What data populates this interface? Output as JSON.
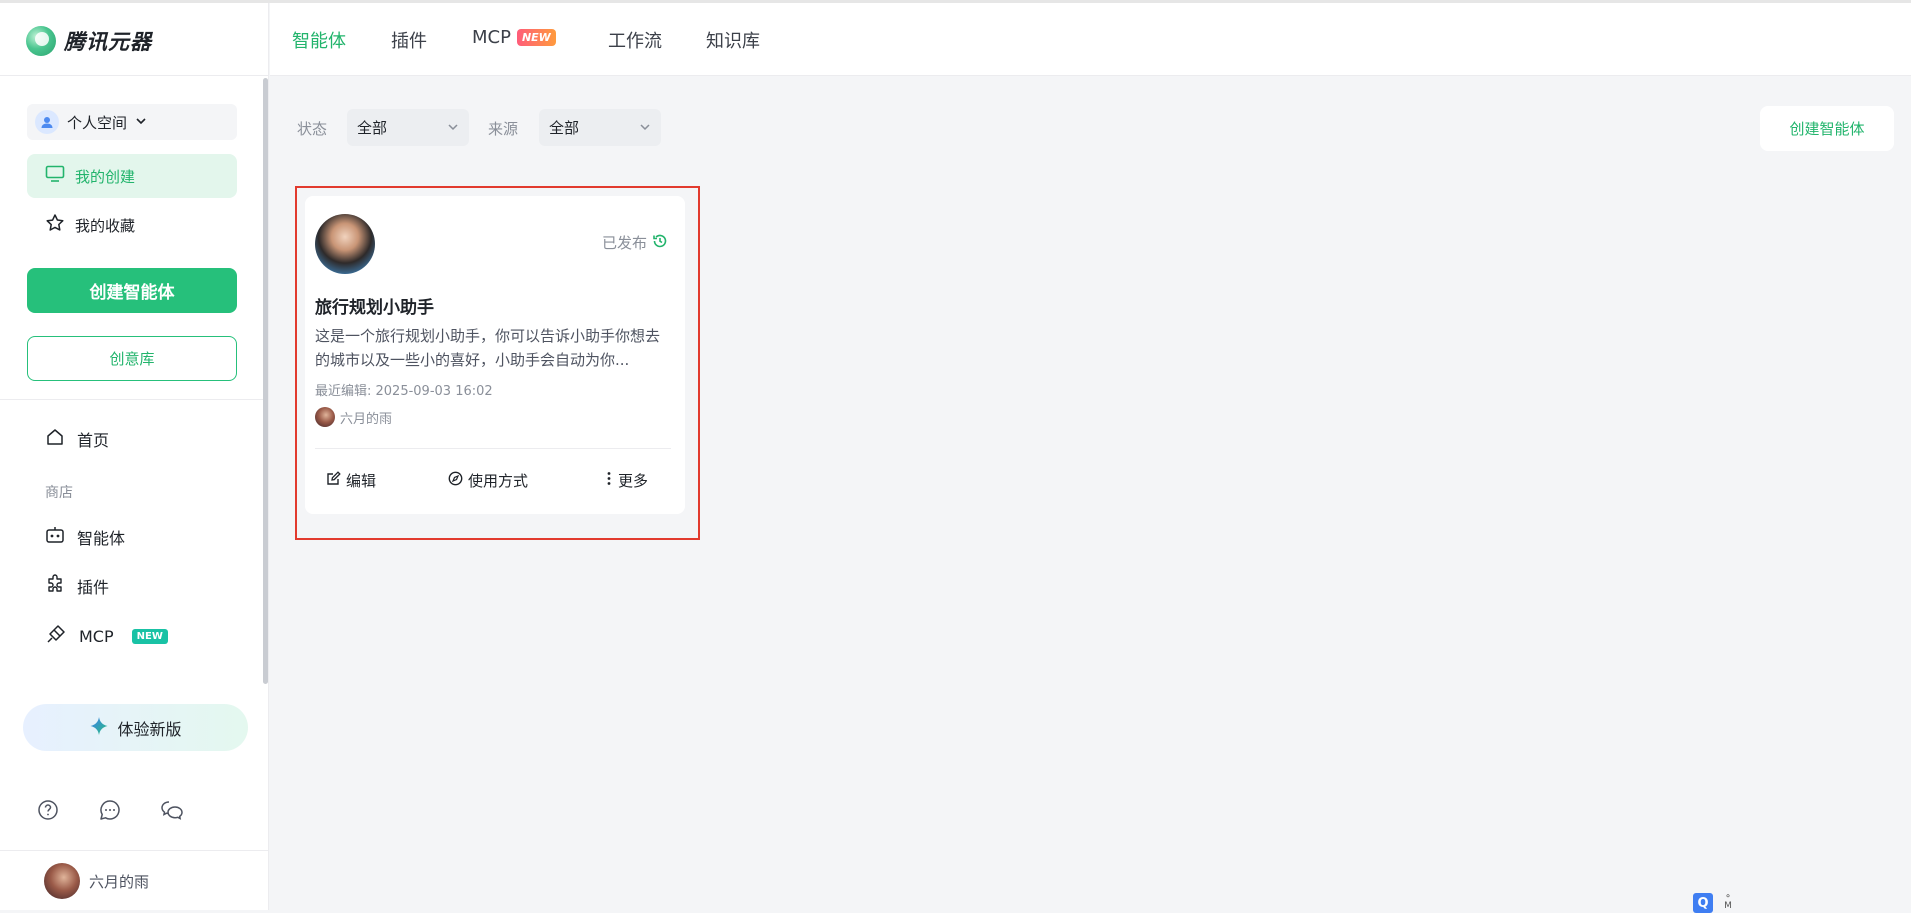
{
  "app": {
    "logo_text": "腾讯元器"
  },
  "sidebar": {
    "space_label": "个人空间",
    "my_created": "我的创建",
    "my_favorites": "我的收藏",
    "create_agent": "创建智能体",
    "idea_library": "创意库",
    "home": "首页",
    "store_section": "商店",
    "store_items": [
      {
        "label": "智能体",
        "icon": "robot-icon"
      },
      {
        "label": "插件",
        "icon": "puzzle-icon"
      },
      {
        "label": "MCP",
        "icon": "plug-icon",
        "badge": "NEW"
      }
    ],
    "try_new_version": "体验新版",
    "bottom_icons": [
      "help-icon",
      "chat-bubble-icon",
      "wechat-icon"
    ],
    "user_name": "六月的雨"
  },
  "topbar": {
    "tabs": [
      {
        "label": "智能体",
        "active": true
      },
      {
        "label": "插件",
        "active": false
      },
      {
        "label": "MCP",
        "active": false,
        "badge": "NEW"
      },
      {
        "label": "工作流",
        "active": false
      },
      {
        "label": "知识库",
        "active": false
      }
    ]
  },
  "filters": {
    "status_label": "状态",
    "status_value": "全部",
    "source_label": "来源",
    "source_value": "全部",
    "create_button": "创建智能体"
  },
  "card": {
    "status": "已发布",
    "title": "旅行规划小助手",
    "description": "这是一个旅行规划小助手，你可以告诉小助手你想去的城市以及一些小的喜好，小助手会自动为你...",
    "last_edited": "最近编辑: 2025-09-03 16:02",
    "author": "六月的雨",
    "actions": {
      "edit": "编辑",
      "usage": "使用方式",
      "more": "更多"
    }
  },
  "colors": {
    "accent": "#26c07b",
    "accent_text": "#22b46c",
    "highlight_frame": "#e23a2e",
    "new_badge": "#19c2a5"
  }
}
